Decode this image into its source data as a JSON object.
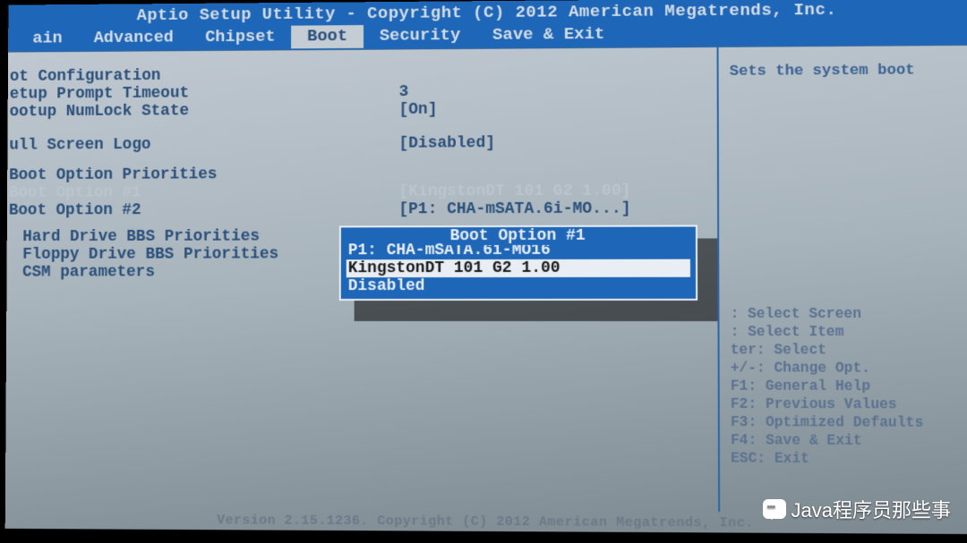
{
  "title": "Aptio Setup Utility - Copyright (C) 2012 American Megatrends, Inc.",
  "tabs": [
    "ain",
    "Advanced",
    "Chipset",
    "Boot",
    "Security",
    "Save & Exit"
  ],
  "active_tab": "Boot",
  "left": {
    "section1_header": "ot Configuration",
    "prompt_timeout_label": "etup Prompt Timeout",
    "prompt_timeout_value": "3",
    "numlock_label": "ootup NumLock State",
    "numlock_value": "[On]",
    "fullscreen_label": "ull Screen Logo",
    "fullscreen_value": "[Disabled]",
    "priorities_header": "Boot Option Priorities",
    "opt1_label": "Boot Option #1",
    "opt1_value": "[KingstonDT 101 G2 1.00]",
    "opt2_label": "Boot Option #2",
    "opt2_value": "[P1: CHA-mSATA.6i-MO...]",
    "hd_bbs": "Hard Drive BBS Priorities",
    "fd_bbs": "Floppy Drive BBS Priorities",
    "csm": "CSM parameters"
  },
  "right": {
    "help_text": "Sets the system boot",
    "keys": [
      ": Select Screen",
      ": Select Item",
      "ter: Select",
      "+/-: Change Opt.",
      "F1: General Help",
      "F2: Previous Values",
      "F3: Optimized Defaults",
      "F4: Save & Exit",
      "ESC: Exit"
    ]
  },
  "popup": {
    "title": "Boot Option #1",
    "items": [
      "P1: CHA-mSATA.6i-MO16",
      "KingstonDT 101 G2 1.00",
      "Disabled"
    ],
    "selected_index": 1
  },
  "footer": "Version 2.15.1236. Copyright (C) 2012 American Megatrends, Inc.",
  "watermark": "Java程序员那些事"
}
